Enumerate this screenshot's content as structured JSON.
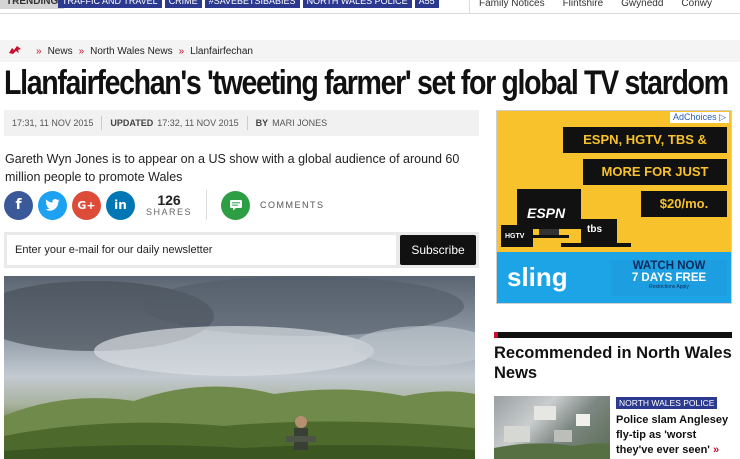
{
  "topbar": {
    "trending_label": "TRENDING",
    "tags": [
      "TRAFFIC AND TRAVEL",
      "CRIME",
      "#SAVEBETSIBABIES",
      "NORTH WALES POLICE",
      "A55"
    ],
    "nav": [
      "Family Notices",
      "Flintshire",
      "Gwynedd",
      "Conwy"
    ]
  },
  "breadcrumb": {
    "items": [
      "News",
      "North Wales News",
      "Llanfairfechan"
    ]
  },
  "article": {
    "headline": "Llanfairfechan's 'tweeting farmer' set for global TV stardom",
    "published": "17:31, 11 NOV 2015",
    "updated_label": "UPDATED",
    "updated": "17:32, 11 NOV 2015",
    "by_label": "BY",
    "author": "MARI JONES",
    "standfirst": "Gareth Wyn Jones is to appear on a US show with a global audience of around 60 million people to promote Wales"
  },
  "share": {
    "count": "126",
    "count_label": "SHARES",
    "comments_label": "COMMENTS",
    "icons": [
      "facebook-icon",
      "twitter-icon",
      "google-plus-icon",
      "linkedin-icon",
      "comment-icon"
    ]
  },
  "newsletter": {
    "placeholder": "Enter your e-mail for our daily newsletter",
    "button": "Subscribe"
  },
  "ad": {
    "adchoices": "AdChoices ▷",
    "line1": "ESPN, HGTV, TBS &",
    "line2": "MORE FOR JUST",
    "price": "$20/mo.",
    "espn": "ESPN",
    "hgtv": "HGTV",
    "tbs": "tbs",
    "sling": "sling",
    "watch1": "WATCH NOW",
    "watch2": "7 DAYS FREE",
    "restrictions": "Restrictions Apply"
  },
  "recommended": {
    "title": "Recommended in North Wales News",
    "tag": "NORTH WALES POLICE",
    "headline": "Police slam Anglesey fly-tip as 'worst they've ever seen'",
    "arrow": "»"
  },
  "colors": {
    "brand_red": "#c8102e",
    "tag_blue": "#2b3a8f",
    "ad_yellow": "#f7c22b",
    "sling_blue": "#1da4e6"
  }
}
